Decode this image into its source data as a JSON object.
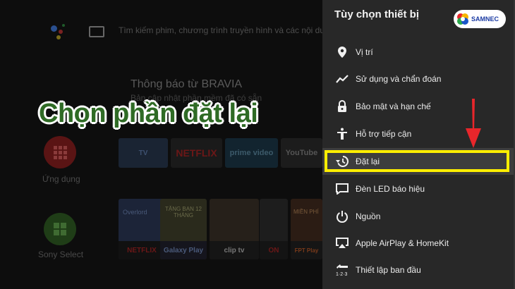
{
  "home": {
    "search_text": "Tìm kiếm phim, chương trình truyền hình và các nội dung khác",
    "notice_title": "Thông báo từ BRAVIA",
    "notice_subtitle": "Bản cập nhật phần mềm đã có sẵn",
    "apps_label": "Ứng dụng",
    "sony_select_label": "Sony Select",
    "app_row": [
      "TV",
      "NETFLIX",
      "prime video",
      "YouTube"
    ],
    "content_row": [
      "NETFLIX",
      "Galaxy Play",
      "clip tv",
      "ON",
      "FPT Play"
    ],
    "content_titles": [
      "Overlord",
      "TẶNG BẠN 12 THÁNG",
      "",
      "",
      "MIỀN PHÍ"
    ]
  },
  "overlay_caption": "Chọn phần đặt lại",
  "panel": {
    "title": "Tùy chọn thiết bị",
    "brand": "SAMNEC",
    "items": [
      {
        "label": "Vị trí",
        "icon": "location-pin-icon"
      },
      {
        "label": "Sử dụng và chẩn đoán",
        "icon": "trend-line-icon"
      },
      {
        "label": "Bảo mật và hạn chế",
        "icon": "lock-icon"
      },
      {
        "label": "Hỗ trợ tiếp cận",
        "icon": "accessibility-icon"
      },
      {
        "label": "Đặt lại",
        "icon": "restore-icon"
      },
      {
        "label": "Đèn LED báo hiệu",
        "icon": "led-message-icon"
      },
      {
        "label": "Nguồn",
        "icon": "power-icon"
      },
      {
        "label": "Apple AirPlay & HomeKit",
        "icon": "airplay-icon"
      },
      {
        "label": "Thiết lập ban đầu",
        "icon": "setup-123-icon"
      }
    ],
    "selected_index": 4
  },
  "colors": {
    "panel_bg": "#282828",
    "highlight": "#ffee00",
    "arrow": "#e8262b",
    "caption": "#2f6b25"
  }
}
